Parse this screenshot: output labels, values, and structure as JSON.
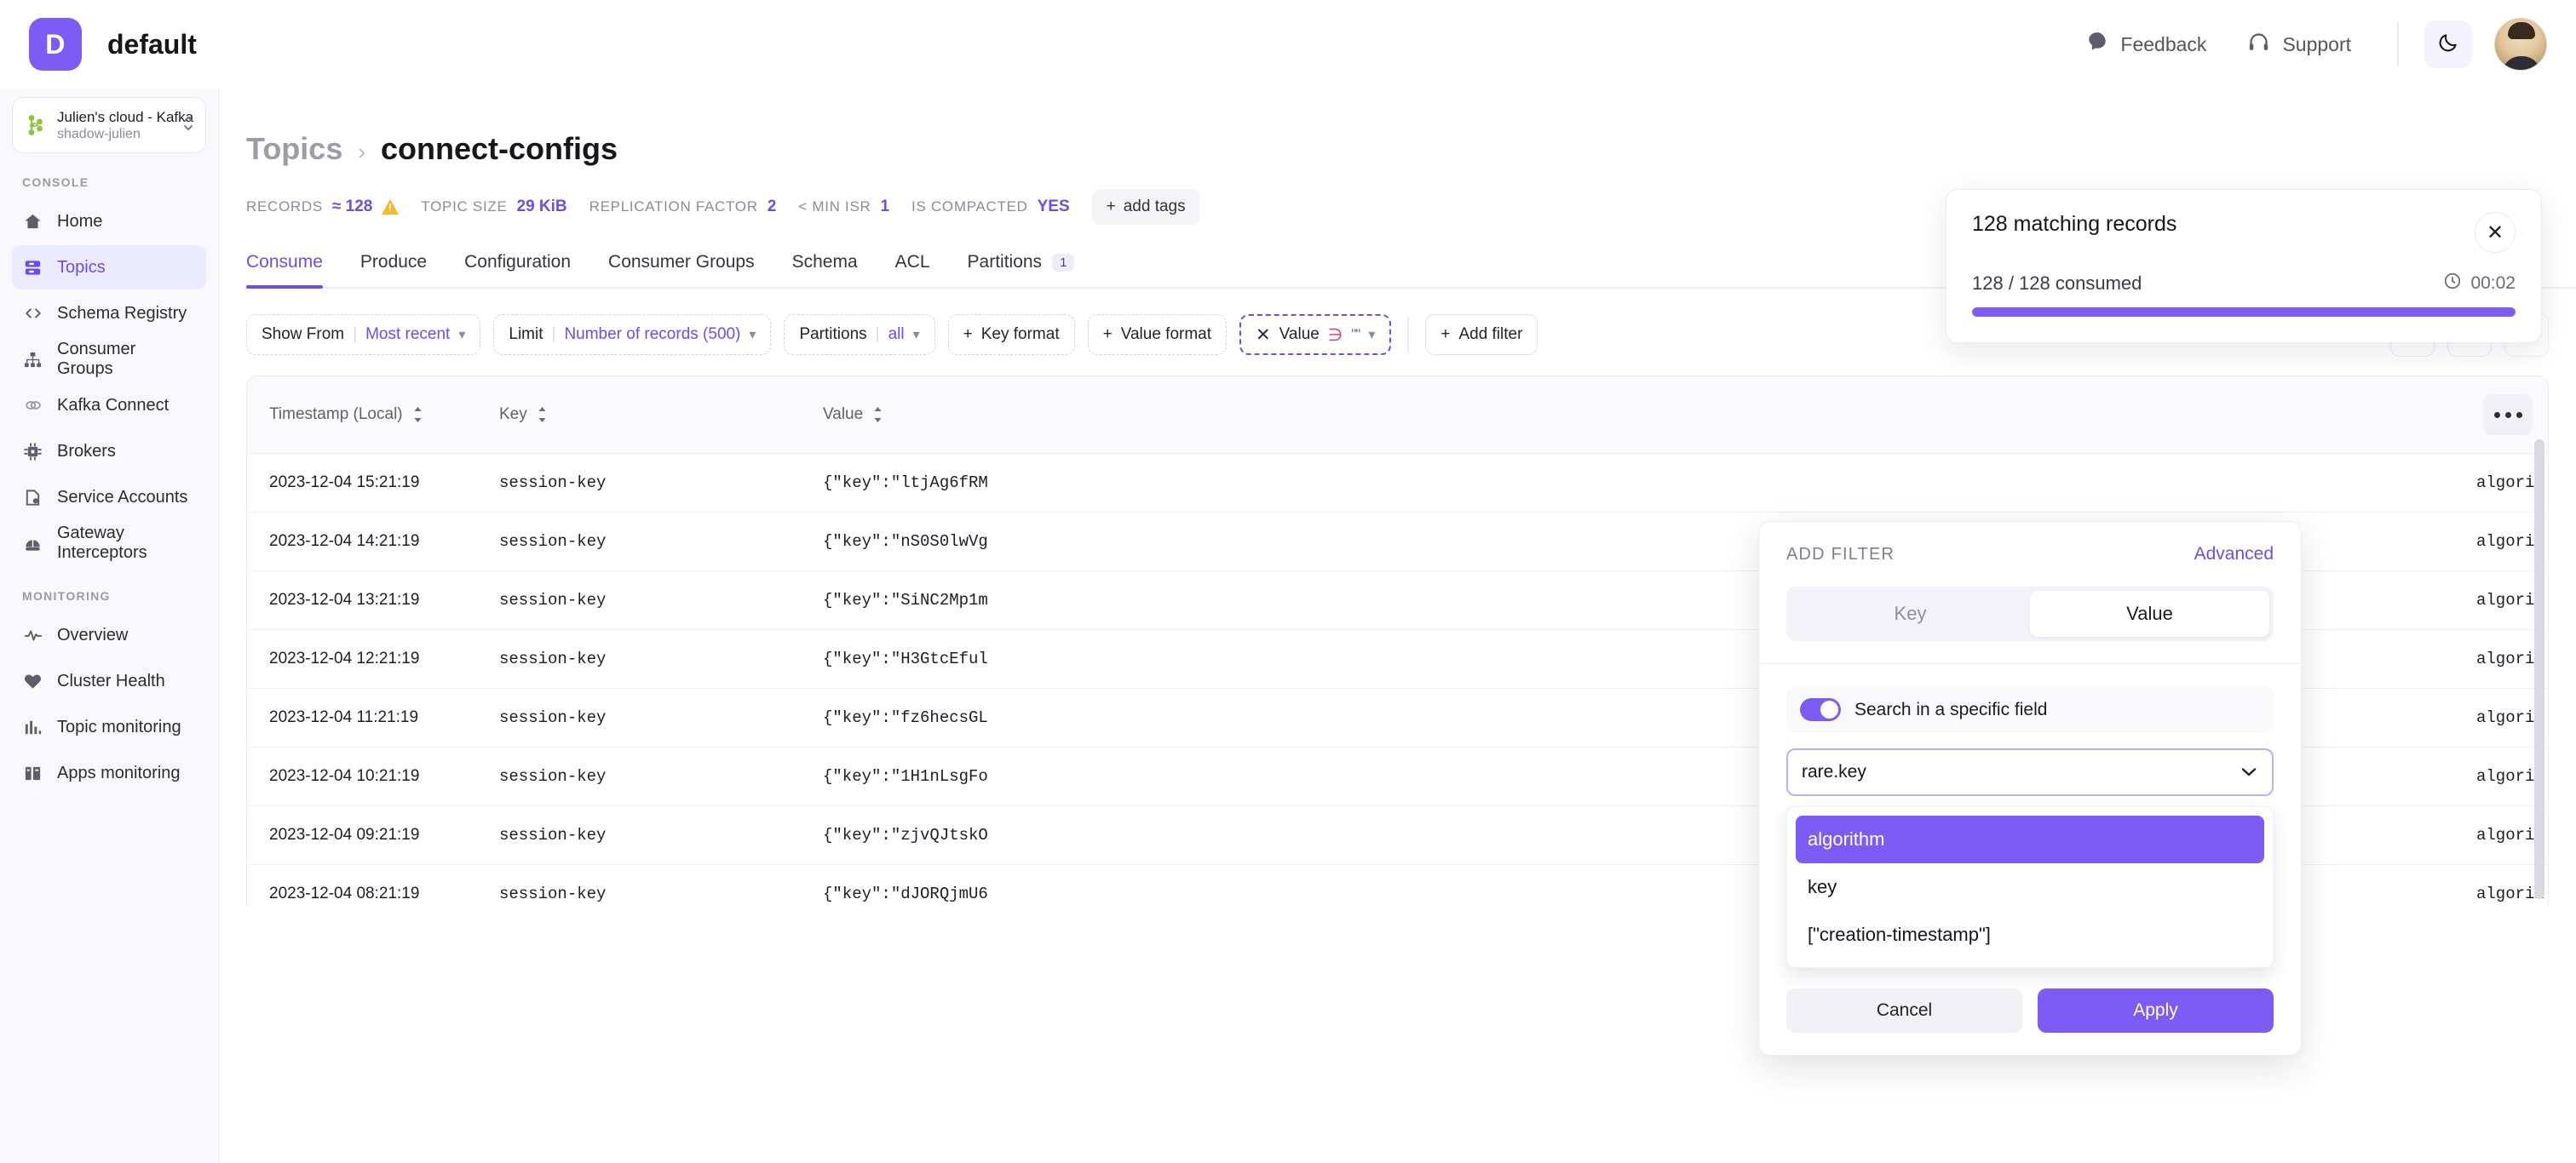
{
  "topbar": {
    "logo_letter": "D",
    "title": "default",
    "feedback_label": "Feedback",
    "support_label": "Support",
    "theme_icon": "moon-icon"
  },
  "sidebar": {
    "cluster": {
      "name": "Julien's cloud - Kafka",
      "sub": "shadow-julien"
    },
    "sections": [
      {
        "label": "CONSOLE",
        "items": [
          {
            "label": "Home",
            "icon": "home-icon",
            "active": false
          },
          {
            "label": "Topics",
            "icon": "topics-icon",
            "active": true
          },
          {
            "label": "Schema Registry",
            "icon": "code-brackets-icon",
            "active": false
          },
          {
            "label": "Consumer Groups",
            "icon": "hierarchy-icon",
            "active": false
          },
          {
            "label": "Kafka Connect",
            "icon": "link-icon",
            "active": false
          },
          {
            "label": "Brokers",
            "icon": "chip-icon",
            "active": false
          },
          {
            "label": "Service Accounts",
            "icon": "file-lock-icon",
            "active": false
          },
          {
            "label": "Gateway Interceptors",
            "icon": "gateway-icon",
            "active": false
          }
        ]
      },
      {
        "label": "MONITORING",
        "items": [
          {
            "label": "Overview",
            "icon": "pulse-icon",
            "active": false
          },
          {
            "label": "Cluster Health",
            "icon": "heart-icon",
            "active": false
          },
          {
            "label": "Topic monitoring",
            "icon": "bar-chart-icon",
            "active": false
          },
          {
            "label": "Apps monitoring",
            "icon": "apps-icon",
            "active": false
          }
        ]
      }
    ]
  },
  "breadcrumb": {
    "parent": "Topics",
    "separator": "›",
    "current": "connect-configs"
  },
  "stats": [
    {
      "key": "RECORDS",
      "value": "≈ 128",
      "warning": true
    },
    {
      "key": "TOPIC SIZE",
      "value": "29 KiB",
      "warning": false
    },
    {
      "key": "REPLICATION FACTOR",
      "value": "2",
      "warning": false
    },
    {
      "key": "< MIN ISR",
      "value": "1",
      "warning": false
    },
    {
      "key": "IS COMPACTED",
      "value": "YES",
      "warning": false
    }
  ],
  "add_tags_label": "add tags",
  "tabs": [
    {
      "label": "Consume",
      "active": true,
      "badge": null
    },
    {
      "label": "Produce",
      "active": false,
      "badge": null
    },
    {
      "label": "Configuration",
      "active": false,
      "badge": null
    },
    {
      "label": "Consumer Groups",
      "active": false,
      "badge": null
    },
    {
      "label": "Schema",
      "active": false,
      "badge": null
    },
    {
      "label": "ACL",
      "active": false,
      "badge": null
    },
    {
      "label": "Partitions",
      "active": false,
      "badge": "1"
    }
  ],
  "filters": {
    "show_from": {
      "label": "Show From",
      "value": "Most recent"
    },
    "limit": {
      "label": "Limit",
      "value": "Number of records (500)"
    },
    "partitions": {
      "label": "Partitions",
      "value": "all"
    },
    "key_format": {
      "label": "Key format"
    },
    "value_format": {
      "label": "Value format"
    },
    "value_filter": {
      "close": "✕",
      "label": "Value",
      "condition": "∋",
      "quote": "\"\""
    },
    "add_filter": {
      "label": "Add filter"
    },
    "toolbar_icons": [
      "refresh-icon",
      "save-icon",
      "folder-icon"
    ]
  },
  "table": {
    "columns": [
      "Timestamp (Local)",
      "Key",
      "Value",
      ""
    ],
    "rows": [
      {
        "timestamp": "2023-12-04 15:21:19",
        "key": "session-key",
        "value": "{\"key\":\"ltjAg6fRM",
        "value_tail": "algorithm\"…"
      },
      {
        "timestamp": "2023-12-04 14:21:19",
        "key": "session-key",
        "value": "{\"key\":\"nS0S0lwVg",
        "value_tail": "algorithm\"…"
      },
      {
        "timestamp": "2023-12-04 13:21:19",
        "key": "session-key",
        "value": "{\"key\":\"SiNC2Mp1m",
        "value_tail": "algorithm\"…"
      },
      {
        "timestamp": "2023-12-04 12:21:19",
        "key": "session-key",
        "value": "{\"key\":\"H3GtcEful",
        "value_tail": "algorithm\"…"
      },
      {
        "timestamp": "2023-12-04 11:21:19",
        "key": "session-key",
        "value": "{\"key\":\"fz6hecsGL",
        "value_tail": "algorithm\"…"
      },
      {
        "timestamp": "2023-12-04 10:21:19",
        "key": "session-key",
        "value": "{\"key\":\"1H1nLsgFo",
        "value_tail": "algorithm\"…"
      },
      {
        "timestamp": "2023-12-04 09:21:19",
        "key": "session-key",
        "value": "{\"key\":\"zjvQJtskO",
        "value_tail": "algorithm\"…"
      },
      {
        "timestamp": "2023-12-04 08:21:19",
        "key": "session-key",
        "value": "{\"key\":\"dJORQjmU6",
        "value_tail": "algorithm\"…"
      }
    ]
  },
  "toast": {
    "title": "128 matching records",
    "consumed": "128 / 128 consumed",
    "elapsed": "00:02",
    "progress_percent": 100,
    "close": "✕"
  },
  "popover": {
    "title": "ADD FILTER",
    "advanced": "Advanced",
    "segments": [
      {
        "label": "Key",
        "selected": false
      },
      {
        "label": "Value",
        "selected": true
      }
    ],
    "toggle_label": "Search in a specific field",
    "toggle_on": true,
    "field_value": "rare.key",
    "options": [
      {
        "label": "algorithm",
        "selected": true
      },
      {
        "label": "key",
        "selected": false
      },
      {
        "label": "[\"creation-timestamp\"]",
        "selected": false
      }
    ],
    "cancel": "Cancel",
    "apply": "Apply"
  },
  "colors": {
    "accent": "#7c5cf5",
    "accent_text": "#6a4df0",
    "warning": "#f7b733",
    "condition": "#d9407f"
  }
}
